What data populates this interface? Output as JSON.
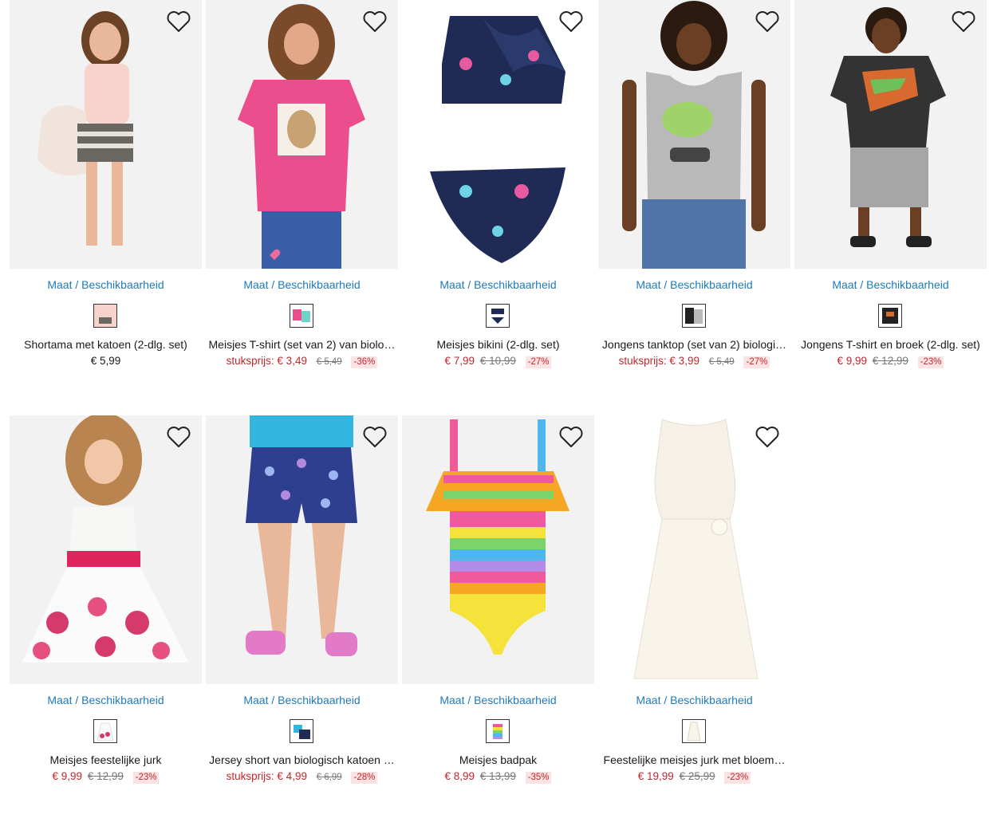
{
  "products": [
    {
      "maat_label": "Maat / Beschikbaarheid",
      "title": "Shortama met katoen (2-dlg. set)",
      "price_label": "",
      "price": "€ 5,99",
      "old_price": "",
      "discount": ""
    },
    {
      "maat_label": "Maat / Beschikbaarheid",
      "title": "Meisjes T-shirt (set van 2) van biolo…",
      "price_label": "stuksprijs:",
      "price": "€ 3,49",
      "old_price": "€ 5,49",
      "discount": "-36%"
    },
    {
      "maat_label": "Maat / Beschikbaarheid",
      "title": "Meisjes bikini (2-dlg. set)",
      "price_label": "",
      "price": "€ 7,99",
      "old_price": "€ 10,99",
      "discount": "-27%"
    },
    {
      "maat_label": "Maat / Beschikbaarheid",
      "title": "Jongens tanktop (set van 2) biologi…",
      "price_label": "stuksprijs:",
      "price": "€ 3,99",
      "old_price": "€ 5,49",
      "discount": "-27%"
    },
    {
      "maat_label": "Maat / Beschikbaarheid",
      "title": "Jongens T-shirt en broek (2-dlg. set)",
      "price_label": "",
      "price": "€ 9,99",
      "old_price": "€ 12,99",
      "discount": "-23%"
    },
    {
      "maat_label": "Maat / Beschikbaarheid",
      "title": "Meisjes feestelijke jurk",
      "price_label": "",
      "price": "€ 9,99",
      "old_price": "€ 12,99",
      "discount": "-23%"
    },
    {
      "maat_label": "Maat / Beschikbaarheid",
      "title": "Jersey short van biologisch katoen …",
      "price_label": "stuksprijs:",
      "price": "€ 4,99",
      "old_price": "€ 6,99",
      "discount": "-28%"
    },
    {
      "maat_label": "Maat / Beschikbaarheid",
      "title": "Meisjes badpak",
      "price_label": "",
      "price": "€ 8,99",
      "old_price": "€ 13,99",
      "discount": "-35%"
    },
    {
      "maat_label": "Maat / Beschikbaarheid",
      "title": "Feestelijke meisjes jurk met bloem…",
      "price_label": "",
      "price": "€ 19,99",
      "old_price": "€ 25,99",
      "discount": "-23%"
    }
  ],
  "colors": {
    "link": "#1f7ab8",
    "sale": "#c0282d",
    "discount_bg": "#fbe3e3"
  },
  "icons": {
    "wishlist": "heart-icon"
  }
}
